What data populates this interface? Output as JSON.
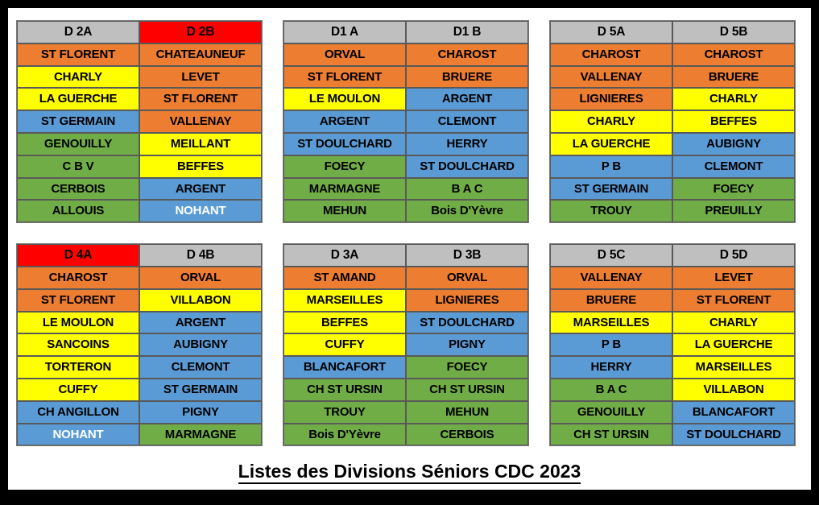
{
  "title": "Listes des Divisions Séniors CDC 2023",
  "colors": {
    "gray": "#BFBFBF",
    "red": "#FF0000",
    "orange": "#ED7D31",
    "yellow": "#FFFF00",
    "blue": "#5B9BD5",
    "green": "#70AD47",
    "frame": "#000000",
    "text": "#000000",
    "text_alt": "#FFFFFF"
  },
  "tables": [
    {
      "id": "d2",
      "rows": [
        [
          {
            "text": "D 2A",
            "color": "gray",
            "header": true
          },
          {
            "text": "D 2B",
            "color": "red",
            "header": true
          }
        ],
        [
          {
            "text": "ST FLORENT",
            "color": "orange"
          },
          {
            "text": "CHATEAUNEUF",
            "color": "orange"
          }
        ],
        [
          {
            "text": "CHARLY",
            "color": "yellow"
          },
          {
            "text": "LEVET",
            "color": "orange"
          }
        ],
        [
          {
            "text": "LA GUERCHE",
            "color": "yellow"
          },
          {
            "text": "ST FLORENT",
            "color": "orange"
          }
        ],
        [
          {
            "text": "ST GERMAIN",
            "color": "blue"
          },
          {
            "text": "VALLENAY",
            "color": "orange"
          }
        ],
        [
          {
            "text": "GENOUILLY",
            "color": "green"
          },
          {
            "text": "MEILLANT",
            "color": "yellow"
          }
        ],
        [
          {
            "text": "C B V",
            "color": "green"
          },
          {
            "text": "BEFFES",
            "color": "yellow"
          }
        ],
        [
          {
            "text": "CERBOIS",
            "color": "green"
          },
          {
            "text": "ARGENT",
            "color": "blue"
          }
        ],
        [
          {
            "text": "ALLOUIS",
            "color": "green"
          },
          {
            "text": "NOHANT",
            "color": "blue",
            "white_text": true
          }
        ]
      ]
    },
    {
      "id": "d1",
      "rows": [
        [
          {
            "text": "D1 A",
            "color": "gray",
            "header": true
          },
          {
            "text": "D1 B",
            "color": "gray",
            "header": true
          }
        ],
        [
          {
            "text": "ORVAL",
            "color": "orange"
          },
          {
            "text": "CHAROST",
            "color": "orange"
          }
        ],
        [
          {
            "text": "ST FLORENT",
            "color": "orange"
          },
          {
            "text": "BRUERE",
            "color": "orange"
          }
        ],
        [
          {
            "text": "LE MOULON",
            "color": "yellow"
          },
          {
            "text": "ARGENT",
            "color": "blue"
          }
        ],
        [
          {
            "text": "ARGENT",
            "color": "blue"
          },
          {
            "text": "CLEMONT",
            "color": "blue"
          }
        ],
        [
          {
            "text": "ST DOULCHARD",
            "color": "blue"
          },
          {
            "text": "HERRY",
            "color": "blue"
          }
        ],
        [
          {
            "text": "FOECY",
            "color": "green"
          },
          {
            "text": "ST DOULCHARD",
            "color": "blue"
          }
        ],
        [
          {
            "text": "MARMAGNE",
            "color": "green"
          },
          {
            "text": "B A C",
            "color": "green"
          }
        ],
        [
          {
            "text": "MEHUN",
            "color": "green"
          },
          {
            "text": "Bois D'Yèvre",
            "color": "green"
          }
        ]
      ]
    },
    {
      "id": "d5ab",
      "rows": [
        [
          {
            "text": "D 5A",
            "color": "gray",
            "header": true
          },
          {
            "text": "D 5B",
            "color": "gray",
            "header": true
          }
        ],
        [
          {
            "text": "CHAROST",
            "color": "orange"
          },
          {
            "text": "CHAROST",
            "color": "orange"
          }
        ],
        [
          {
            "text": "VALLENAY",
            "color": "orange"
          },
          {
            "text": "BRUERE",
            "color": "orange"
          }
        ],
        [
          {
            "text": "LIGNIERES",
            "color": "orange"
          },
          {
            "text": "CHARLY",
            "color": "yellow"
          }
        ],
        [
          {
            "text": "CHARLY",
            "color": "yellow"
          },
          {
            "text": "BEFFES",
            "color": "yellow"
          }
        ],
        [
          {
            "text": "LA GUERCHE",
            "color": "yellow"
          },
          {
            "text": "AUBIGNY",
            "color": "blue"
          }
        ],
        [
          {
            "text": "P B",
            "color": "blue"
          },
          {
            "text": "CLEMONT",
            "color": "blue"
          }
        ],
        [
          {
            "text": "ST GERMAIN",
            "color": "blue"
          },
          {
            "text": "FOECY",
            "color": "green"
          }
        ],
        [
          {
            "text": "TROUY",
            "color": "green"
          },
          {
            "text": "PREUILLY",
            "color": "green"
          }
        ]
      ]
    },
    {
      "id": "d4",
      "rows": [
        [
          {
            "text": "D 4A",
            "color": "red",
            "header": true
          },
          {
            "text": "D 4B",
            "color": "gray",
            "header": true
          }
        ],
        [
          {
            "text": "CHAROST",
            "color": "orange"
          },
          {
            "text": "ORVAL",
            "color": "orange"
          }
        ],
        [
          {
            "text": "ST FLORENT",
            "color": "orange"
          },
          {
            "text": "VILLABON",
            "color": "yellow"
          }
        ],
        [
          {
            "text": "LE MOULON",
            "color": "yellow"
          },
          {
            "text": "ARGENT",
            "color": "blue"
          }
        ],
        [
          {
            "text": "SANCOINS",
            "color": "yellow"
          },
          {
            "text": "AUBIGNY",
            "color": "blue"
          }
        ],
        [
          {
            "text": "TORTERON",
            "color": "yellow"
          },
          {
            "text": "CLEMONT",
            "color": "blue"
          }
        ],
        [
          {
            "text": "CUFFY",
            "color": "yellow"
          },
          {
            "text": "ST GERMAIN",
            "color": "blue"
          }
        ],
        [
          {
            "text": "CH ANGILLON",
            "color": "blue"
          },
          {
            "text": "PIGNY",
            "color": "blue"
          }
        ],
        [
          {
            "text": "NOHANT",
            "color": "blue",
            "white_text": true
          },
          {
            "text": "MARMAGNE",
            "color": "green"
          }
        ]
      ]
    },
    {
      "id": "d3",
      "rows": [
        [
          {
            "text": "D 3A",
            "color": "gray",
            "header": true
          },
          {
            "text": "D 3B",
            "color": "gray",
            "header": true
          }
        ],
        [
          {
            "text": "ST AMAND",
            "color": "orange"
          },
          {
            "text": "ORVAL",
            "color": "orange"
          }
        ],
        [
          {
            "text": "MARSEILLES",
            "color": "yellow"
          },
          {
            "text": "LIGNIERES",
            "color": "orange"
          }
        ],
        [
          {
            "text": "BEFFES",
            "color": "yellow"
          },
          {
            "text": "ST DOULCHARD",
            "color": "blue"
          }
        ],
        [
          {
            "text": "CUFFY",
            "color": "yellow"
          },
          {
            "text": "PIGNY",
            "color": "blue"
          }
        ],
        [
          {
            "text": "BLANCAFORT",
            "color": "blue"
          },
          {
            "text": "FOECY",
            "color": "green"
          }
        ],
        [
          {
            "text": "CH ST URSIN",
            "color": "green"
          },
          {
            "text": "CH ST URSIN",
            "color": "green"
          }
        ],
        [
          {
            "text": "TROUY",
            "color": "green"
          },
          {
            "text": "MEHUN",
            "color": "green"
          }
        ],
        [
          {
            "text": "Bois D'Yèvre",
            "color": "green"
          },
          {
            "text": "CERBOIS",
            "color": "green"
          }
        ]
      ]
    },
    {
      "id": "d5cd",
      "rows": [
        [
          {
            "text": "D 5C",
            "color": "gray",
            "header": true
          },
          {
            "text": "D 5D",
            "color": "gray",
            "header": true
          }
        ],
        [
          {
            "text": "VALLENAY",
            "color": "orange"
          },
          {
            "text": "LEVET",
            "color": "orange"
          }
        ],
        [
          {
            "text": "BRUERE",
            "color": "orange"
          },
          {
            "text": "ST FLORENT",
            "color": "orange"
          }
        ],
        [
          {
            "text": "MARSEILLES",
            "color": "yellow"
          },
          {
            "text": "CHARLY",
            "color": "yellow"
          }
        ],
        [
          {
            "text": "P B",
            "color": "blue"
          },
          {
            "text": "LA GUERCHE",
            "color": "yellow"
          }
        ],
        [
          {
            "text": "HERRY",
            "color": "blue"
          },
          {
            "text": "MARSEILLES",
            "color": "yellow"
          }
        ],
        [
          {
            "text": "B A C",
            "color": "green"
          },
          {
            "text": "VILLABON",
            "color": "yellow"
          }
        ],
        [
          {
            "text": "GENOUILLY",
            "color": "green"
          },
          {
            "text": "BLANCAFORT",
            "color": "blue"
          }
        ],
        [
          {
            "text": "CH ST URSIN",
            "color": "green"
          },
          {
            "text": "ST DOULCHARD",
            "color": "blue"
          }
        ]
      ]
    }
  ]
}
